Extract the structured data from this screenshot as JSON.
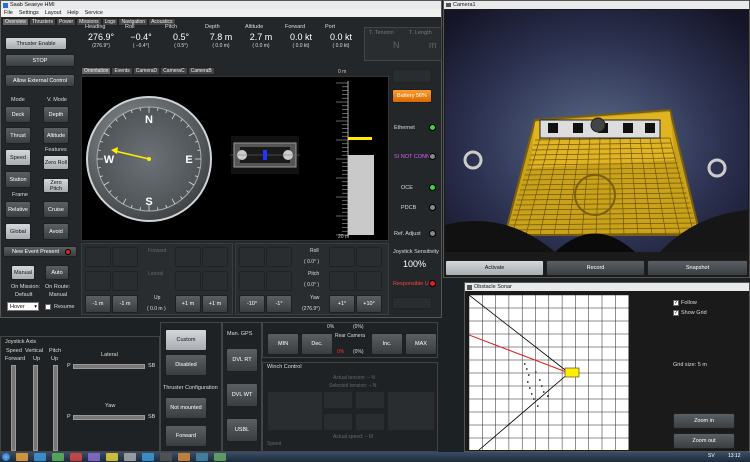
{
  "window": {
    "title": "Saab Seaeye HMI",
    "menu": [
      "File",
      "Settings",
      "Layout",
      "Help",
      "Service"
    ],
    "tabs": [
      "Overview",
      "Thrusters",
      "Power",
      "Missions",
      "Logs",
      "Navigation",
      "Acoustics"
    ]
  },
  "telemetry": [
    {
      "label": "Heading",
      "value": "276.9°",
      "sub": "(276.9°)"
    },
    {
      "label": "Roll",
      "value": "−0.4°",
      "sub": "( −0.4°)"
    },
    {
      "label": "Pitch",
      "value": "0.5°",
      "sub": "( 0.5°)"
    },
    {
      "label": "Depth",
      "value": "7.8 m",
      "sub": "( 0.0 m)"
    },
    {
      "label": "Altitude",
      "value": "2.7 m",
      "sub": "( 0.0 m)"
    },
    {
      "label": "Forward",
      "value": "0.0 kt",
      "sub": "( 0.0 kt)"
    },
    {
      "label": "Port",
      "value": "0.0 kt",
      "sub": "( 0.0 kt)"
    }
  ],
  "tension": {
    "t_tension": "T. Tension",
    "t_length": "T. Length",
    "dash1": "N",
    "dash2": "m"
  },
  "left": {
    "thruster_enable": "Thruster Enable",
    "stop": "STOP",
    "allow_ext": "Allow External Control",
    "mode": "Mode",
    "vmode": "V. Mode",
    "deck": "Deck",
    "depth": "Depth",
    "thrust": "Thrust",
    "altitude": "Altitude",
    "speed": "Speed",
    "features": "Features",
    "zero_roll": "Zero Roll",
    "station": "Station",
    "zero_pitch": "Zero Pitch",
    "frame": "Frame",
    "relative": "Relative",
    "cruise": "Cruise",
    "global": "Global",
    "avoid": "Avoid",
    "new_event": "New Event Present",
    "manual": "Manual",
    "auto": "Auto",
    "on_mission": "On Mission:",
    "default": "Default",
    "on_route": "On Route:",
    "manual2": "Manual",
    "hover": "Hover",
    "resume": "Resume"
  },
  "view_tabs": [
    "Orientation",
    "Events",
    "CameraD",
    "CameraC",
    "CameraB"
  ],
  "depth_gauge": {
    "top": "0 m",
    "bottom": "20 m"
  },
  "right_status": {
    "battery": "Battery 56%",
    "ethernet": "Ethernet",
    "not_conn": "SI NOT CONN",
    "oce": "OCE",
    "pdcb": "PDCB",
    "ref_adjust": "Ref. Adjust",
    "joy_sens": "Joystick Sensitivity",
    "joy_val": "100%",
    "responsible": "Responsible Unit"
  },
  "adjust": {
    "forward": "Forward",
    "lateral": "Lateral",
    "up": "Up",
    "up_val": "0.0 m",
    "roll": "Roll",
    "roll_val": "0.0°",
    "pitch": "Pitch",
    "pitch_val": "0.0°",
    "yaw": "Yaw",
    "yaw_val": "276.9°",
    "b1": [
      "-1 m",
      "-1 m",
      "+1 m",
      "+1 m"
    ],
    "b2": [
      "-10°",
      "-1°",
      "+1°",
      "+10°"
    ]
  },
  "camera": {
    "title": "Camera1",
    "activate": "Activate",
    "record": "Record",
    "snapshot": "Snapshot"
  },
  "sonar": {
    "title": "Obstacle Sonar",
    "follow": "Follow",
    "show_grid": "Show Grid",
    "grid_size": "Grid size: 5 m",
    "zoom_in": "Zoom in",
    "zoom_out": "Zoom out"
  },
  "joystick": {
    "title": "Joystick Axis",
    "speed": "Speed",
    "vertical": "Vertical",
    "pitch": "Pitch",
    "forward": "Forward",
    "up": "Up",
    "up2": "Up",
    "lateral": "Lateral",
    "yaw": "Yaw",
    "p": "P",
    "sb": "SB"
  },
  "mid": {
    "custom": "Custom",
    "disabled": "Disabled",
    "thr_config": "Thruster Configuration",
    "not_mounted": "Not mounted",
    "forward": "Forward",
    "man_gps": "Man. GPS",
    "dvl_rt": "DVL RT",
    "dvl_wt": "DVL WT",
    "usbl": "USBL",
    "min": "MIN",
    "dec": "Dec.",
    "inc": "Inc.",
    "max": "MAX",
    "rear_camera": "Rear Camera",
    "pct": "0%",
    "pct2": "(0%)",
    "winch": "Winch Control",
    "actual_tension": "Actual tension: – N",
    "selected_tension": "Selected tension: – N",
    "actual_speed": "Actual speed: – M",
    "speed": "Speed"
  },
  "taskbar": {
    "clock": "13:12",
    "lang": "SV"
  }
}
